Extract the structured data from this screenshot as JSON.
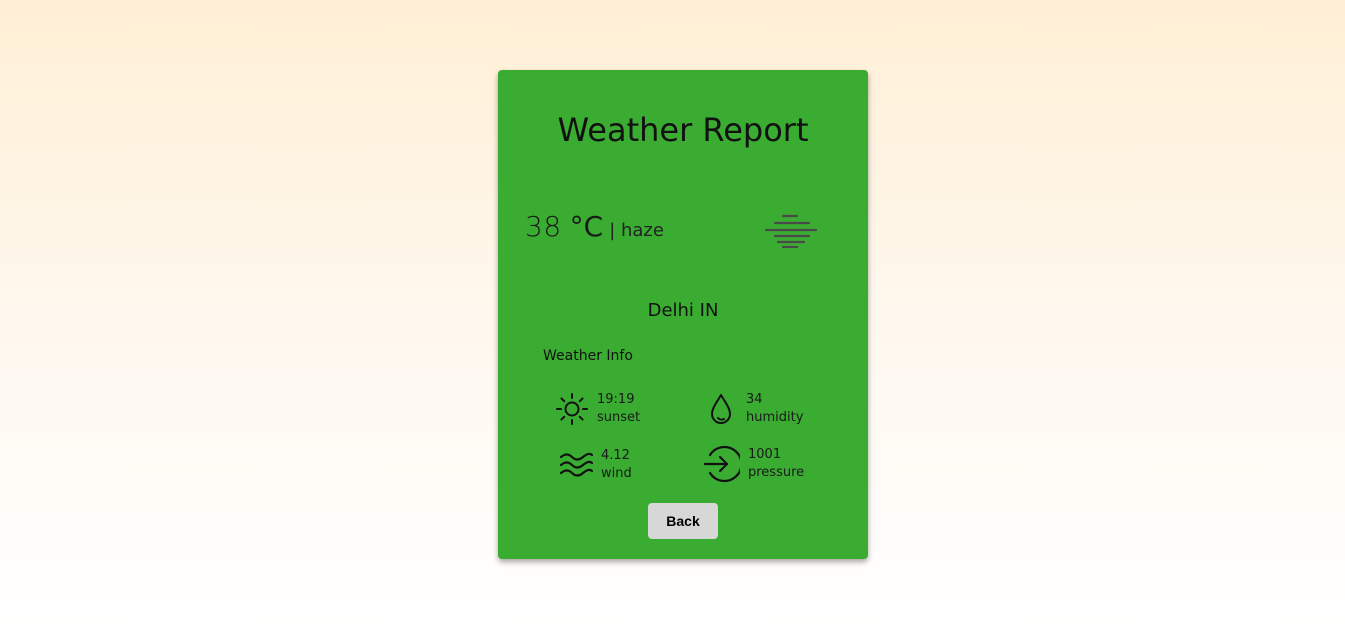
{
  "card": {
    "title": "Weather Report",
    "temperature": "38",
    "unit": "°C",
    "description": "| haze",
    "condition_icon": "haze-icon",
    "location": "Delhi IN",
    "info_heading": "Weather Info",
    "info": [
      {
        "icon": "sun-icon",
        "value": "19:19",
        "label": "sunset"
      },
      {
        "icon": "water-drop-icon",
        "value": "34",
        "label": "humidity"
      },
      {
        "icon": "wind-icon",
        "value": "4.12",
        "label": "wind"
      },
      {
        "icon": "pressure-arrow-icon",
        "value": "1001",
        "label": "pressure"
      }
    ],
    "back_label": "Back"
  },
  "colors": {
    "card_background": "#3aac31",
    "button_background": "#d7d7d7",
    "page_gradient_top": "#ffefd5",
    "page_gradient_bottom": "#ffffff"
  }
}
